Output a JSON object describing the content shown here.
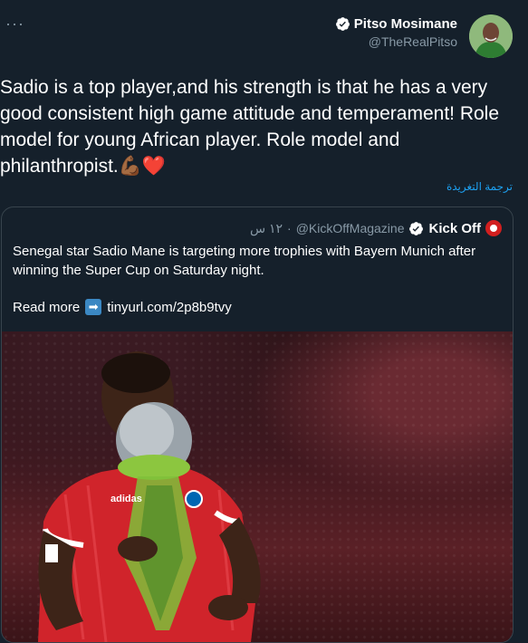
{
  "tweet": {
    "more_label": "···",
    "author_name": "Pitso Mosimane",
    "author_handle": "@TheRealPitso",
    "text": "Sadio is a top player,and his strength is that he has a very good consistent high game attitude and temperament! Role model for young African player. Role model and philanthropist.💪🏾❤️",
    "translate_label": "ترجمة التغريدة"
  },
  "quote": {
    "author_name": "Kick Off",
    "author_handle": "@KickOffMagazine",
    "separator": "·",
    "time": "١٢ س",
    "text": "Senegal star Sadio Mane is targeting more trophies with Bayern Munich after winning the Super Cup on Saturday night.",
    "read_more_label": "Read more",
    "arrow_icon": "➡",
    "link": "tinyurl.com/2p8b9tvy"
  },
  "colors": {
    "background": "#15202b",
    "secondary_text": "#8899a6",
    "accent": "#1da1f2",
    "border": "#38444d",
    "bayern_red": "#d0242b"
  }
}
